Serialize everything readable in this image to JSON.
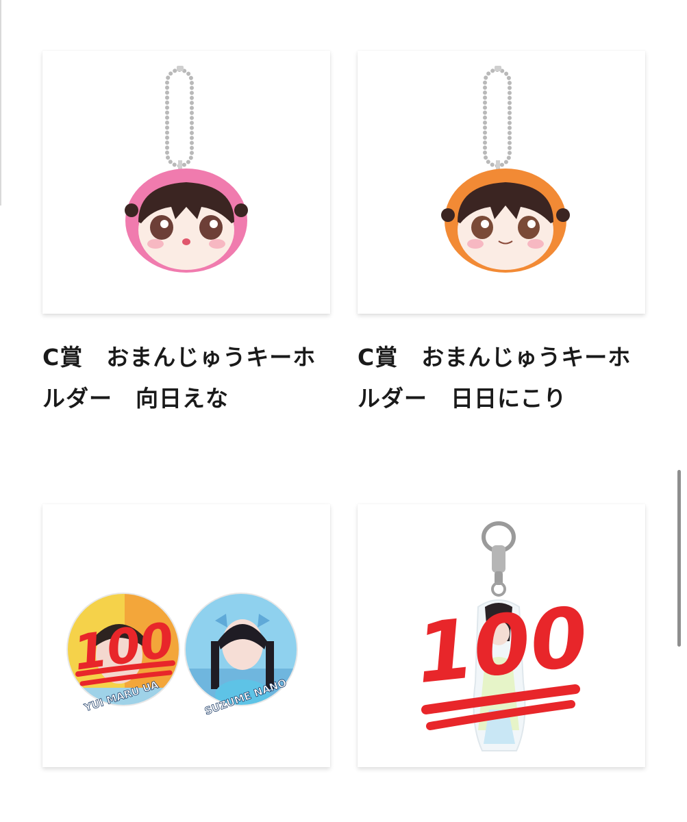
{
  "products": [
    {
      "title": "C賞　おまんじゅうキーホルダー　向日えな",
      "image_desc_icon": "pink-manju-keychain-image",
      "hood_color": "#f07bae"
    },
    {
      "title": "C賞　おまんじゅうキーホルダー　日日にこり",
      "image_desc_icon": "orange-manju-keychain-image",
      "hood_color": "#f28a35"
    },
    {
      "badge_left_text": "YUI MARU UA",
      "badge_right_text": "SUZUME NANO",
      "emoji_text": "100",
      "image_desc_icon": "can-badge-set-image"
    },
    {
      "emoji_text": "100",
      "image_desc_icon": "acrylic-keychain-image"
    }
  ],
  "colors": {
    "emoji_red": "#e8262a",
    "scrollbar": "#8e8e8e"
  }
}
